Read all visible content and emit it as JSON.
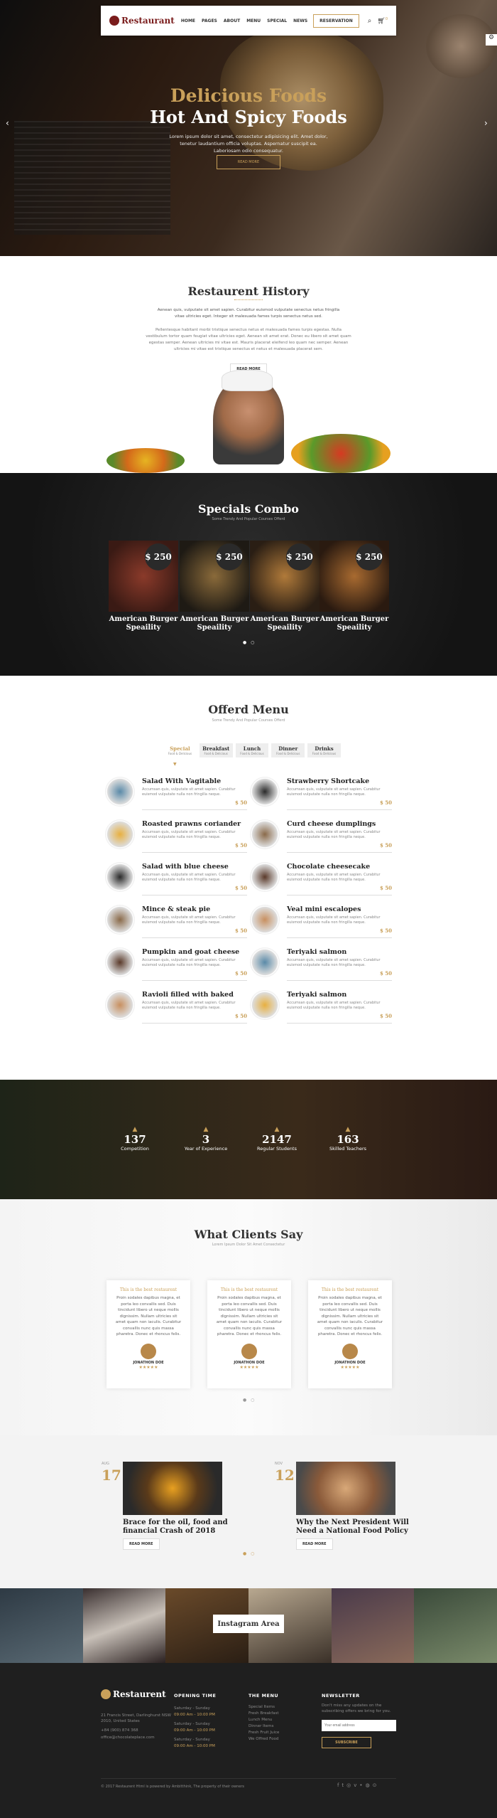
{
  "nav": {
    "logo": "Restaurant",
    "items": [
      "HOME",
      "PAGES",
      "ABOUT",
      "MENU",
      "SPECIAL",
      "NEWS"
    ],
    "reservation": "RESERVATION",
    "cart_count": "0"
  },
  "hero": {
    "title1": "Delicious Foods",
    "title2": "Hot And Spicy Foods",
    "desc": "Lorem ipsum dolor sit amet, consectetur adipisicing elit. Amet dolor, tenetur laudantium officia voluptas. Aspernatur suscipit ea. Laboriosam odio consequatur.",
    "button": "READ MORE"
  },
  "history": {
    "title": "Restaurent History",
    "quote": "Aenean quis, vulputate sit amet sapien. Curabitur euismod vulputate senectus netus fringilla vitae ultricies eget. Integer sit malesuada fames turpis senectus netus sed.",
    "body": "Pellentesque habitant morbi tristique senectus netus et malesuada fames turpis egestas. Nulla vestibulum tortor quam feugiat vitae ultricies eget. Aenean sit amet erat. Donec eu libero sit amet quam egestas semper. Aenean ultricies mi vitae est. Mauris placerat eleifend leo quam nec semper. Aenean ultricies mi vitae est tristique senectus et netus et malesuada placerat sem.",
    "button": "READ MORE"
  },
  "specials": {
    "title": "Specials Combo",
    "subtitle": "Some Trendy And Popular Courses Offerd",
    "items": [
      {
        "price": "$ 250",
        "name": "American Burger Speaility"
      },
      {
        "price": "$ 250",
        "name": "American Burger Speaility"
      },
      {
        "price": "$ 250",
        "name": "American Burger Speaility"
      },
      {
        "price": "$ 250",
        "name": "American Burger Speaility"
      }
    ]
  },
  "menu": {
    "title": "Offerd Menu",
    "subtitle": "Some Trendy And Popular Courses Offerd",
    "tabs": [
      {
        "label": "Special",
        "sub": "Food & Delicious"
      },
      {
        "label": "Breakfast",
        "sub": "Food & Delicious"
      },
      {
        "label": "Lunch",
        "sub": "Food & Delicious"
      },
      {
        "label": "Dinner",
        "sub": "Food & Delicious"
      },
      {
        "label": "Drinks",
        "sub": "Food & Delicious"
      }
    ],
    "desc": "Accumsan quis, vulputate sit amet sapien. Curabitur euismod vulputate nulla non fringilla neque.",
    "left": [
      {
        "name": "Salad With Vagitable",
        "price": "$ 50"
      },
      {
        "name": "Roasted prawns coriander",
        "price": "$ 50"
      },
      {
        "name": "Salad with blue cheese",
        "price": "$ 50"
      },
      {
        "name": "Mince & steak pie",
        "price": "$ 50"
      },
      {
        "name": "Pumpkin and goat cheese",
        "price": "$ 50"
      },
      {
        "name": "Ravioli filled with baked",
        "price": "$ 50"
      }
    ],
    "right": [
      {
        "name": "Strawberry Shortcake",
        "price": "$ 50"
      },
      {
        "name": "Curd cheese dumplings",
        "price": "$ 50"
      },
      {
        "name": "Chocolate cheesecake",
        "price": "$ 50"
      },
      {
        "name": "Veal mini escalopes",
        "price": "$ 50"
      },
      {
        "name": "Teriyaki salmon",
        "price": "$ 50"
      },
      {
        "name": "Teriyaki salmon",
        "price": "$ 50"
      }
    ]
  },
  "stats": [
    {
      "n": "137",
      "l": "Competition"
    },
    {
      "n": "3",
      "l": "Year of Experience"
    },
    {
      "n": "2147",
      "l": "Regular Students"
    },
    {
      "n": "163",
      "l": "Skilled Teachers"
    }
  ],
  "clients": {
    "title": "What Clients Say",
    "subtitle": "Lorem Ipsum Dolor Sit Amet Consectetur",
    "items": [
      {
        "head": "This is the best restaurent",
        "text": "Proin sodales dapibus magna, et porta leo convallis sed. Duis tincidunt libero ut neque mollis dignissim. Nullam ultricies sit amet quam non iaculis. Curabitur convallis nunc quis massa pharetra. Donec et rhoncus felis.",
        "name": "JONATHON DOE",
        "stars": "★★★★★"
      },
      {
        "head": "This is the best restaurent",
        "text": "Proin sodales dapibus magna, et porta leo convallis sed. Duis tincidunt libero ut neque mollis dignissim. Nullam ultricies sit amet quam non iaculis. Curabitur convallis nunc quis massa pharetra. Donec et rhoncus felis.",
        "name": "JONATHON DOE",
        "stars": "★★★★★"
      },
      {
        "head": "This is the best restaurent",
        "text": "Proin sodales dapibus magna, et porta leo convallis sed. Duis tincidunt libero ut neque mollis dignissim. Nullam ultricies sit amet quam non iaculis. Curabitur convallis nunc quis massa pharetra. Donec et rhoncus felis.",
        "name": "JONATHON DOE",
        "stars": "★★★★★"
      }
    ]
  },
  "blog": [
    {
      "month": "AUG",
      "day": "17",
      "title": "Brace for the oil, food and financial Crash of 2018",
      "button": "READ MORE"
    },
    {
      "month": "NOV",
      "day": "12",
      "title": "Why the Next President Will Need a National Food Policy",
      "button": "READ MORE"
    }
  ],
  "instagram": "Instagram Area",
  "footer": {
    "logo": "Restaurent",
    "address": "21 Francis Street, Darlinghurst NSW 2010, United States",
    "phone": "+84 (900) 874 368",
    "email": "office@chocolateplace.com",
    "opening_title": "OPENING TIME",
    "opening": [
      {
        "d": "Saturday - Sunday",
        "t": "09:00 Am - 10:00 PM"
      },
      {
        "d": "Saturday - Sunday",
        "t": "09:00 Am - 10:00 PM"
      },
      {
        "d": "Saturday - Sunday",
        "t": "09:00 Am - 10:00 PM"
      }
    ],
    "menu_title": "THE MENU",
    "menu": [
      "Special Items",
      "Fresh Breakfast",
      "Lunch Menu",
      "Dinner Items",
      "Fresh Fruit Juice",
      "We Offred Food"
    ],
    "news_title": "NEWSLETTER",
    "news_text": "Don't miss any updates on the subscribing offers we bring for you.",
    "news_placeholder": "Your email address",
    "subscribe": "SUBSCRIBE",
    "copyright": "© 2017 Restaurent Html is powered by Ambitthink, The property of their owners"
  }
}
